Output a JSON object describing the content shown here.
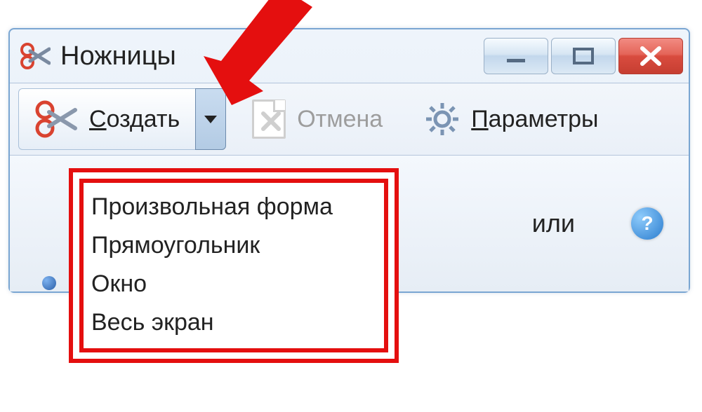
{
  "window": {
    "title": "Ножницы"
  },
  "toolbar": {
    "create_label": "Создать",
    "cancel_label": "Отмена",
    "params_label": "Параметры"
  },
  "dropdown": {
    "items": [
      "Произвольная форма",
      "Прямоугольник",
      "Окно",
      "Весь экран"
    ]
  },
  "partial_visible_text": "или",
  "colors": {
    "annotation_red": "#e40f0f"
  }
}
